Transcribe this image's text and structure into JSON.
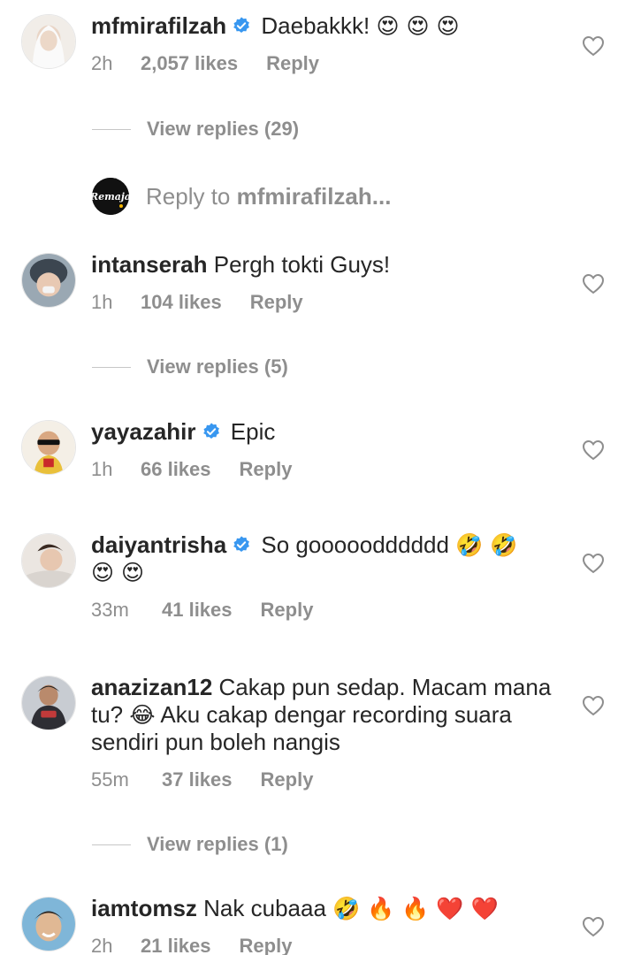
{
  "comments": [
    {
      "username": "mfmirafilzah",
      "verified": true,
      "text": "Daebakkk!",
      "emojis": "😍 😍 😍",
      "time": "2h",
      "likes": "2,057 likes",
      "reply": "Reply"
    },
    {
      "username": "intanserah",
      "verified": false,
      "text": "Pergh tokti Guys!",
      "time": "1h",
      "likes": "104 likes",
      "reply": "Reply"
    },
    {
      "username": "yayazahir",
      "verified": true,
      "text": "Epic",
      "time": "1h",
      "likes": "66 likes",
      "reply": "Reply"
    },
    {
      "username": "daiyantrisha",
      "verified": true,
      "text": "So gooooodddddd",
      "emojis": "🤣 🤣",
      "emojis_line2": "😍 😍",
      "time": "33m",
      "likes": "41 likes",
      "reply": "Reply"
    },
    {
      "username": "anazizan12",
      "verified": false,
      "text": "Cakap pun sedap. Macam mana tu?",
      "emoji_mid": "😂",
      "text2": "Aku cakap dengar recording suara sendiri pun boleh nangis",
      "time": "55m",
      "likes": "37 likes",
      "reply": "Reply"
    },
    {
      "username": "iamtomsz",
      "verified": false,
      "text": "Nak cubaaa",
      "emojis": "🤣 🔥 🔥 ❤️ ❤️",
      "time": "2h",
      "likes": "21 likes",
      "reply": "Reply"
    }
  ],
  "view_replies": [
    "View replies (29)",
    "View replies (5)",
    "View replies (1)"
  ],
  "reply_compose": {
    "prefix": "Reply to",
    "target": "mfmirafilzah..."
  },
  "mini_avatar_text": "Remaja",
  "colors": {
    "text": "#262626",
    "secondary": "#8e8e8e",
    "verified": "#3897f0",
    "divider": "#c7c7c7"
  },
  "icons": [
    "verified-badge-icon",
    "heart-outline-icon"
  ]
}
